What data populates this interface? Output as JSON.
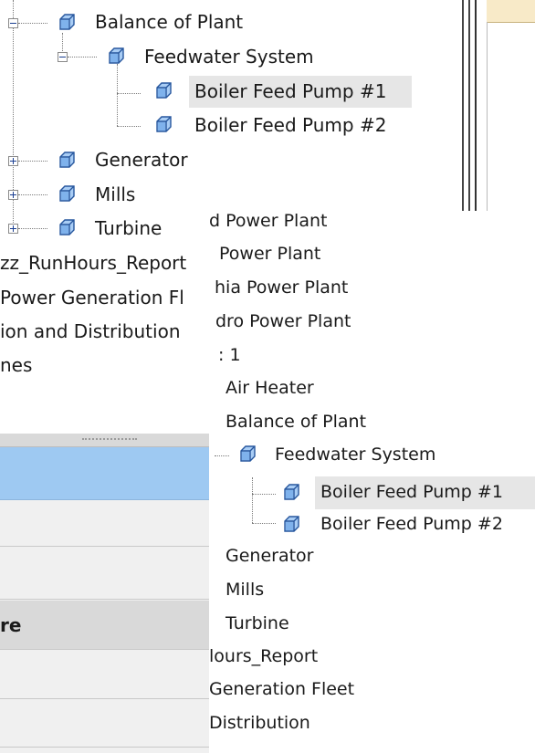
{
  "tree_back": {
    "balance_of_plant": "Balance of Plant",
    "feedwater_system": "Feedwater System",
    "boiler_feed_pump_1": "Boiler Feed Pump #1",
    "boiler_feed_pump_2": "Boiler Feed Pump #2",
    "generator": "Generator",
    "mills": "Mills",
    "turbine": "Turbine",
    "runhours_report": "zz_RunHours_Report",
    "power_generation_fleet": "Power Generation Fl",
    "transmission_distribution": "ion and Distribution",
    "lines": "nes"
  },
  "tree_front": {
    "power_plant_1": "d Power Plant",
    "power_plant_2": "Power Plant",
    "power_plant_3": "hia Power Plant",
    "hydro_power_plant": "dro Power Plant",
    "unit_1": ": 1",
    "air_heater": "Air Heater",
    "balance_of_plant": "Balance of Plant",
    "feedwater_system": "Feedwater System",
    "boiler_feed_pump_1": "Boiler Feed Pump #1",
    "boiler_feed_pump_2": "Boiler Feed Pump #2",
    "generator": "Generator",
    "mills": "Mills",
    "turbine": "Turbine",
    "runhours_report": "lours_Report",
    "generation_fleet": "Generation Fleet",
    "distribution": "Distribution"
  },
  "panel": {
    "row_label": "re"
  },
  "colors": {
    "selected_row": "#9ec9f2",
    "header": "#d4d4d4",
    "row": "#f0f0f0",
    "top_strip": "#f8eac8"
  }
}
